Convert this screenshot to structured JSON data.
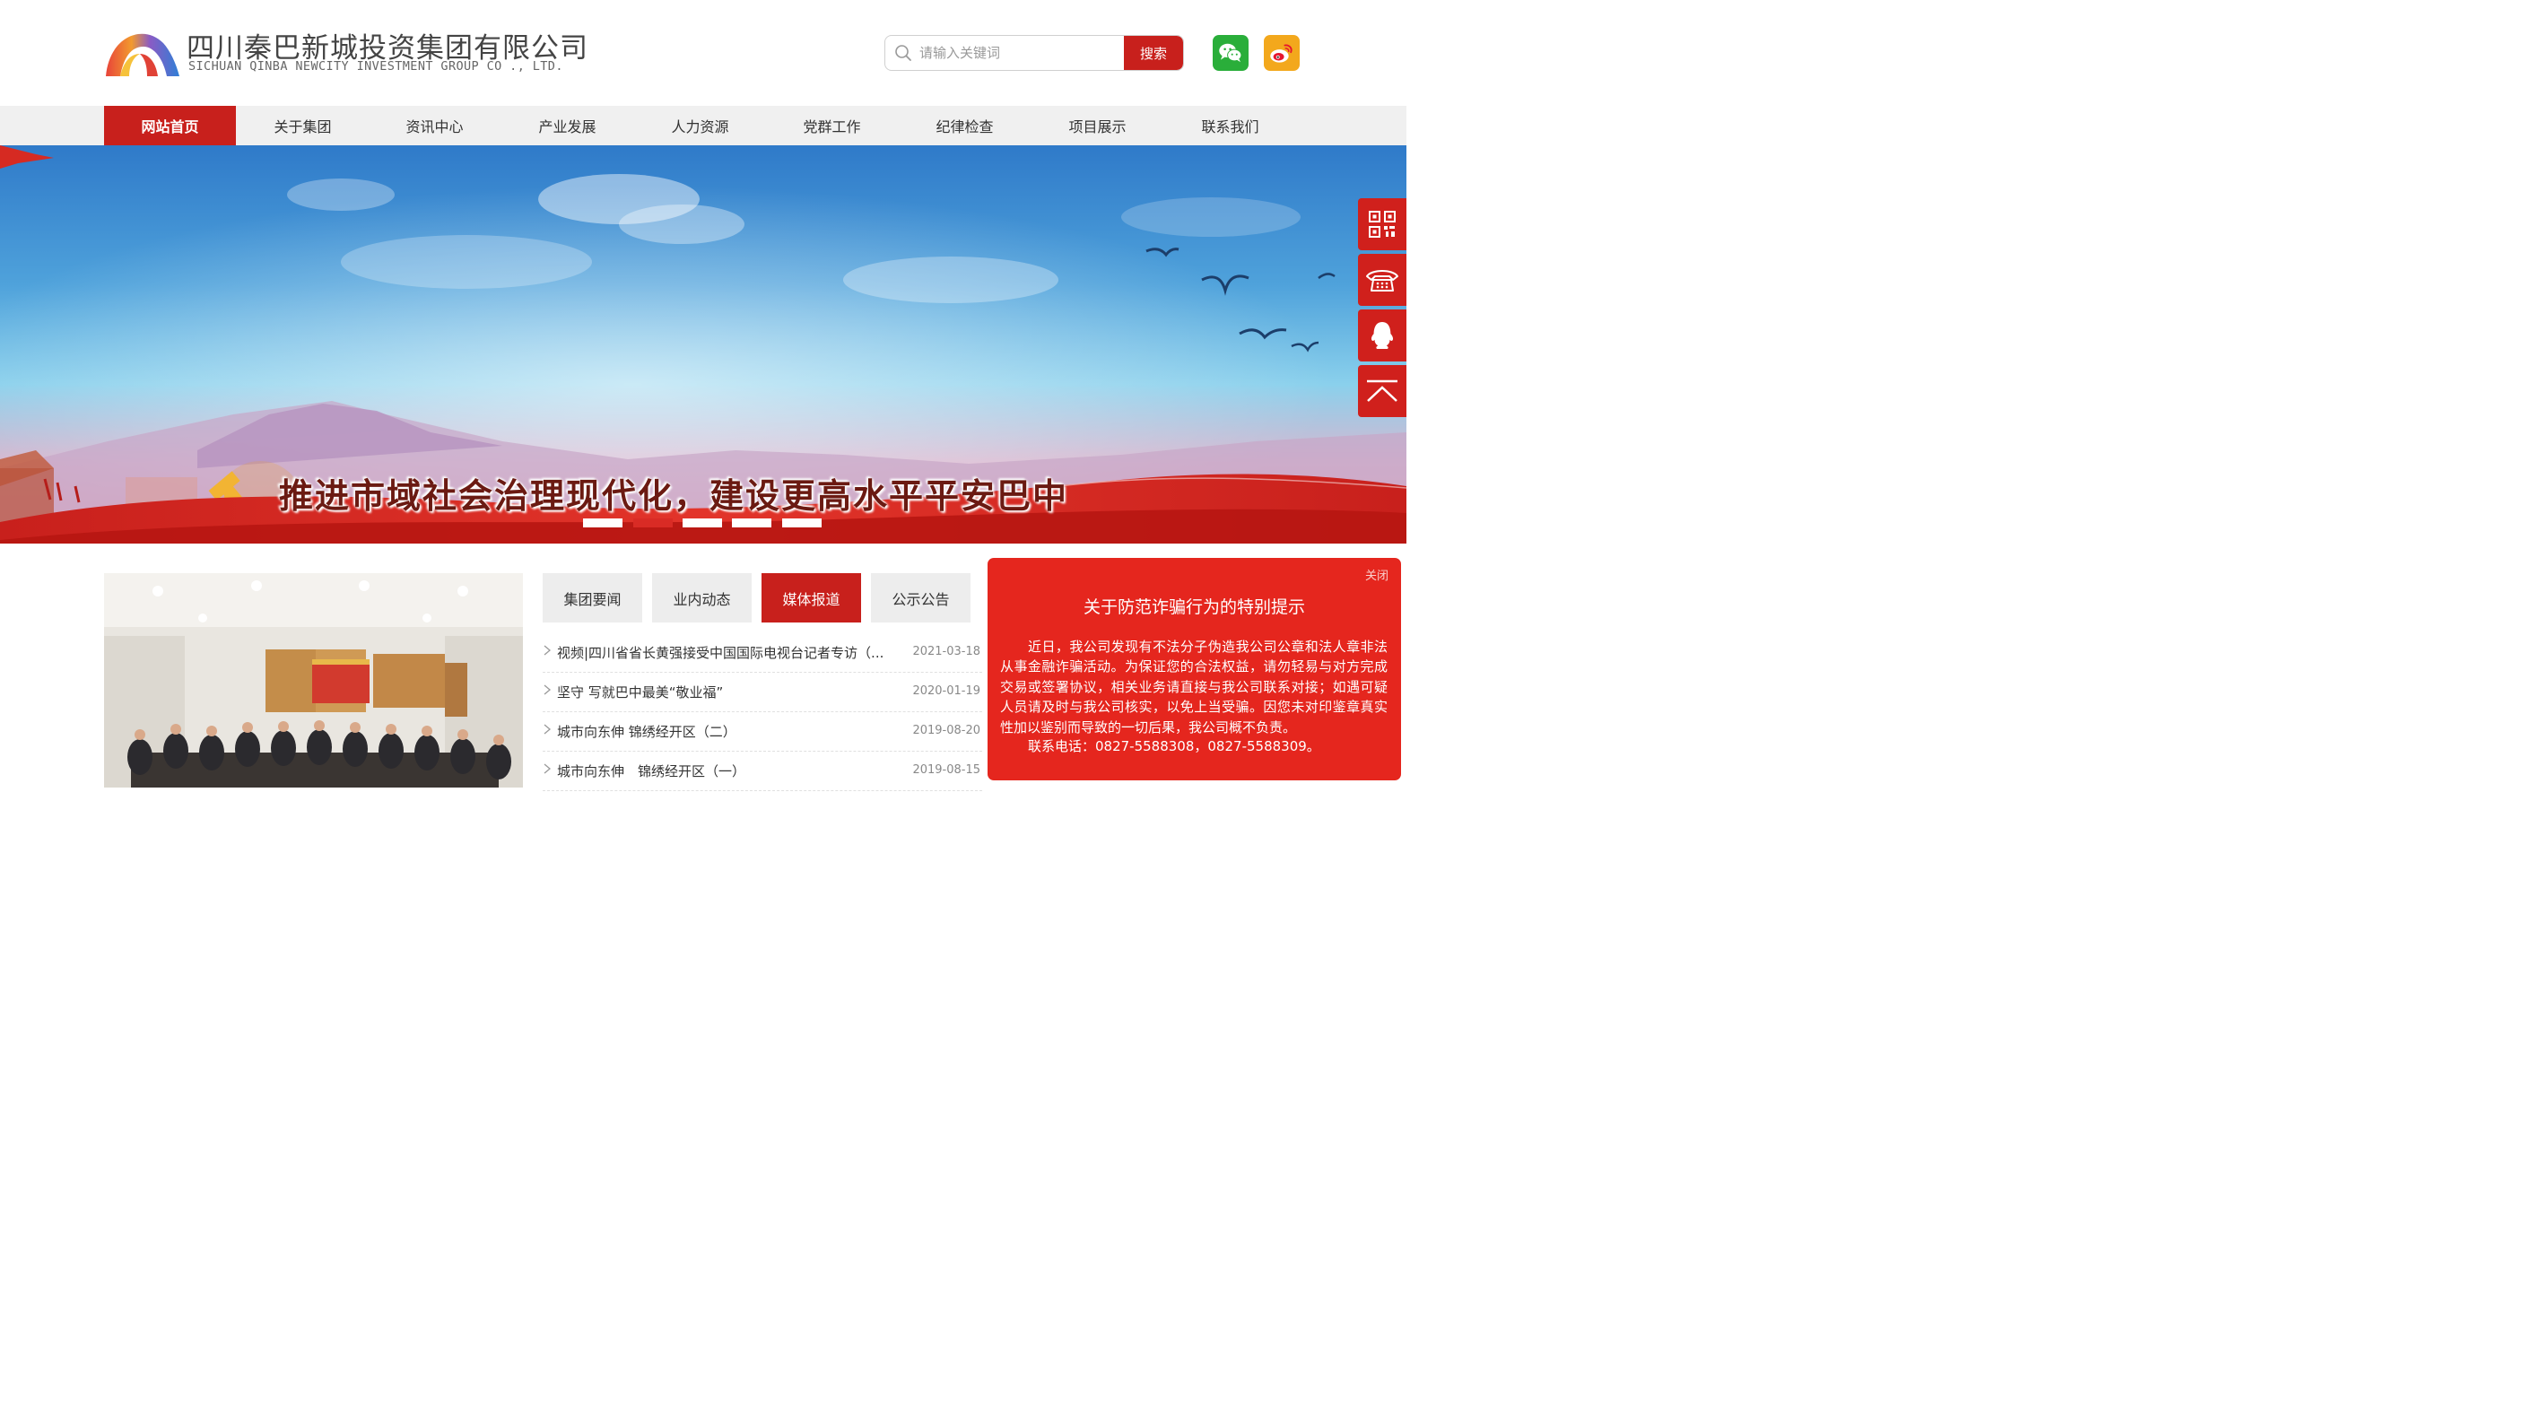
{
  "header": {
    "company_cn": "四川秦巴新城投资集团有限公司",
    "company_en": "SICHUAN QINBA NEWCITY INVESTMENT GROUP CO ., LTD.",
    "search_placeholder": "请输入关键词",
    "search_button": "搜索"
  },
  "nav": {
    "items": [
      {
        "label": "网站首页",
        "active": true
      },
      {
        "label": "关于集团"
      },
      {
        "label": "资讯中心"
      },
      {
        "label": "产业发展"
      },
      {
        "label": "人力资源"
      },
      {
        "label": "党群工作"
      },
      {
        "label": "纪律检查"
      },
      {
        "label": "项目展示"
      },
      {
        "label": "联系我们"
      }
    ]
  },
  "banner": {
    "title": "推进市域社会治理现代化，建设更高水平平安巴中",
    "active_slide": 2,
    "slide_count": 5
  },
  "tabs": [
    {
      "label": "集团要闻"
    },
    {
      "label": "业内动态"
    },
    {
      "label": "媒体报道",
      "active": true
    },
    {
      "label": "公示公告"
    }
  ],
  "news": [
    {
      "title": "视频|四川省省长黄强接受中国国际电视台记者专访（...",
      "date": "2021-03-18"
    },
    {
      "title": "坚守 写就巴中最美“敬业福”",
      "date": "2020-01-19"
    },
    {
      "title": "城市向东伸 锦绣经开区（二）",
      "date": "2019-08-20"
    },
    {
      "title": "城市向东伸　锦绣经开区（一）",
      "date": "2019-08-15"
    }
  ],
  "popup": {
    "close": "关闭",
    "title": "关于防范诈骗行为的特别提示",
    "body": "近日，我公司发现有不法分子伪造我公司公章和法人章非法从事金融诈骗活动。为保证您的合法权益，请勿轻易与对方完成交易或签署协议，相关业务请直接与我公司联系对接；如遇可疑人员请及时与我公司核实，以免上当受骗。因您未对印鉴章真实性加以鉴别而导致的一切后果，我公司概不负责。",
    "phone": "联系电话：0827-5588308，0827-5588309。"
  },
  "icons": {
    "wechat": "wechat-icon",
    "weibo": "weibo-icon",
    "qrcode": "qrcode-icon",
    "phone": "phone-icon",
    "qq": "qq-icon",
    "top": "back-to-top-icon"
  },
  "colors": {
    "brand_red": "#c8201c",
    "popup_red": "#e5261e",
    "nav_bg": "#f0f0f0"
  }
}
